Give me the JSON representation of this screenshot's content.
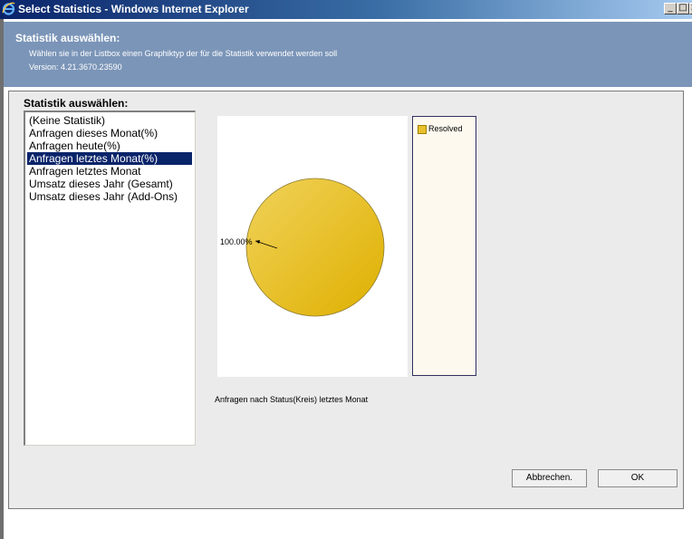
{
  "window": {
    "title": "Select Statistics - Windows Internet Explorer",
    "icon": "ie-icon",
    "minimize_label": "_",
    "maximize_label": "□",
    "close_label": "×"
  },
  "header": {
    "title": "Statistik auswählen:",
    "subtitle": "Wählen sie in der Listbox einen Graphiktyp der für die Statistik verwendet werden soll",
    "version": "Version: 4.21.3670.23590"
  },
  "section": {
    "label": "Statistik auswählen:"
  },
  "statistics_list": {
    "items": [
      {
        "label": "(Keine Statistik)",
        "selected": false
      },
      {
        "label": "Anfragen dieses Monat(%)",
        "selected": false
      },
      {
        "label": "Anfragen heute(%)",
        "selected": false
      },
      {
        "label": "Anfragen letztes Monat(%)",
        "selected": true
      },
      {
        "label": "Anfragen letztes Monat",
        "selected": false
      },
      {
        "label": "Umsatz dieses Jahr (Gesamt)",
        "selected": false
      },
      {
        "label": "Umsatz dieses Jahr (Add-Ons)",
        "selected": false
      }
    ]
  },
  "chart": {
    "caption": "Anfragen nach Status(Kreis) letztes Monat",
    "legend_label": "Resolved",
    "slice_label": "100.00%"
  },
  "chart_data": {
    "type": "pie",
    "categories": [
      "Resolved"
    ],
    "values": [
      100.0
    ],
    "slice_labels": [
      "100.00%"
    ],
    "colors": [
      "#e9c02e"
    ],
    "legend_position": "right"
  },
  "buttons": {
    "cancel_label": "Abbrechen.",
    "ok_label": "OK"
  },
  "colors": {
    "title_bar": "#0a246a",
    "header_panel": "#7b95b8",
    "selection": "#0a246a",
    "pie_slice": "#e9c02e",
    "legend_bg": "#fdf9ef"
  }
}
